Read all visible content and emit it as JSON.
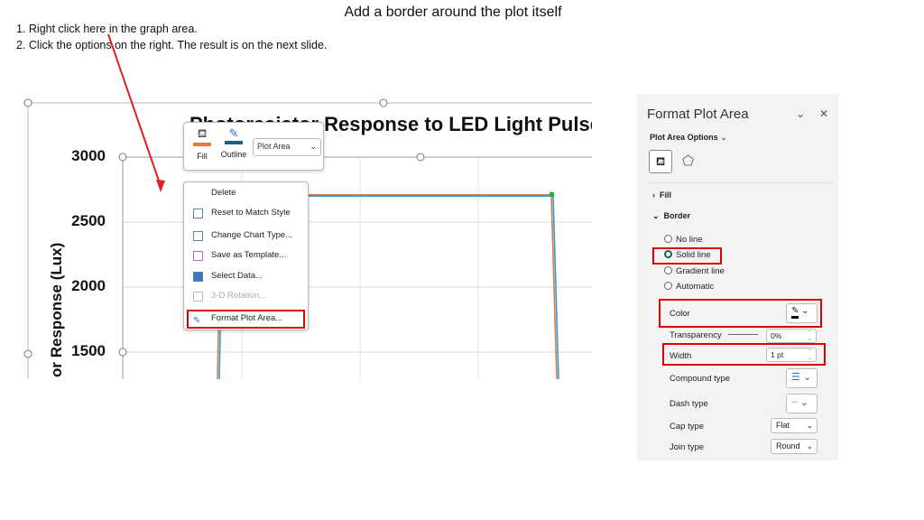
{
  "slide": {
    "title": "Add a border around the plot itself",
    "steps": [
      "1. Right click here in the graph area.",
      "2. Click the options on the right.  The result is on the next slide."
    ],
    "arrow_color": "#e02020",
    "highlight_color": "#e00000"
  },
  "chart_data": {
    "type": "line",
    "title": "Photoresistor Response to LED Light Pulse",
    "ylabel": "or Response (Lux)",
    "ytick_labels": [
      "3000",
      "2500",
      "2000",
      "1500"
    ],
    "ylim_visible": [
      1300,
      3150
    ],
    "grid": true,
    "series": [
      {
        "color": "#e07b39",
        "plateau": 2710
      },
      {
        "color": "#2a9fd6",
        "plateau": 2700
      }
    ]
  },
  "mini_toolbar": {
    "fill": "Fill",
    "outline": "Outline",
    "element_select": "Plot Area",
    "fill_color": "#e07b39",
    "outline_color": "#1e5f86"
  },
  "context_menu": {
    "items": [
      {
        "label": "Delete",
        "icon": "none",
        "enabled": true
      },
      {
        "label": "Reset to Match Style",
        "icon": "reset-style-icon",
        "enabled": true
      },
      {
        "label": "Change Chart Type...",
        "icon": "chart-type-icon",
        "enabled": true
      },
      {
        "label": "Save as Template...",
        "icon": "template-icon",
        "enabled": true
      },
      {
        "label": "Select Data...",
        "icon": "select-data-icon",
        "enabled": true
      },
      {
        "label": "3-D Rotation...",
        "icon": "rotation-icon",
        "enabled": false
      },
      {
        "label": "Format Plot Area...",
        "icon": "format-icon",
        "enabled": true
      }
    ]
  },
  "panel": {
    "title": "Format Plot Area",
    "options": "Plot Area Options",
    "fill": "Fill",
    "border": "Border",
    "radios": [
      "No line",
      "Solid line",
      "Gradient line",
      "Automatic"
    ],
    "selected_radio": "Solid line",
    "color": "Color",
    "transparency": "Transparency",
    "transparency_value": "0%",
    "width": "Width",
    "width_value": "1 pt",
    "compound": "Compound type",
    "dash": "Dash type",
    "cap": "Cap type",
    "cap_value": "Flat",
    "join": "Join type",
    "join_value": "Round"
  }
}
